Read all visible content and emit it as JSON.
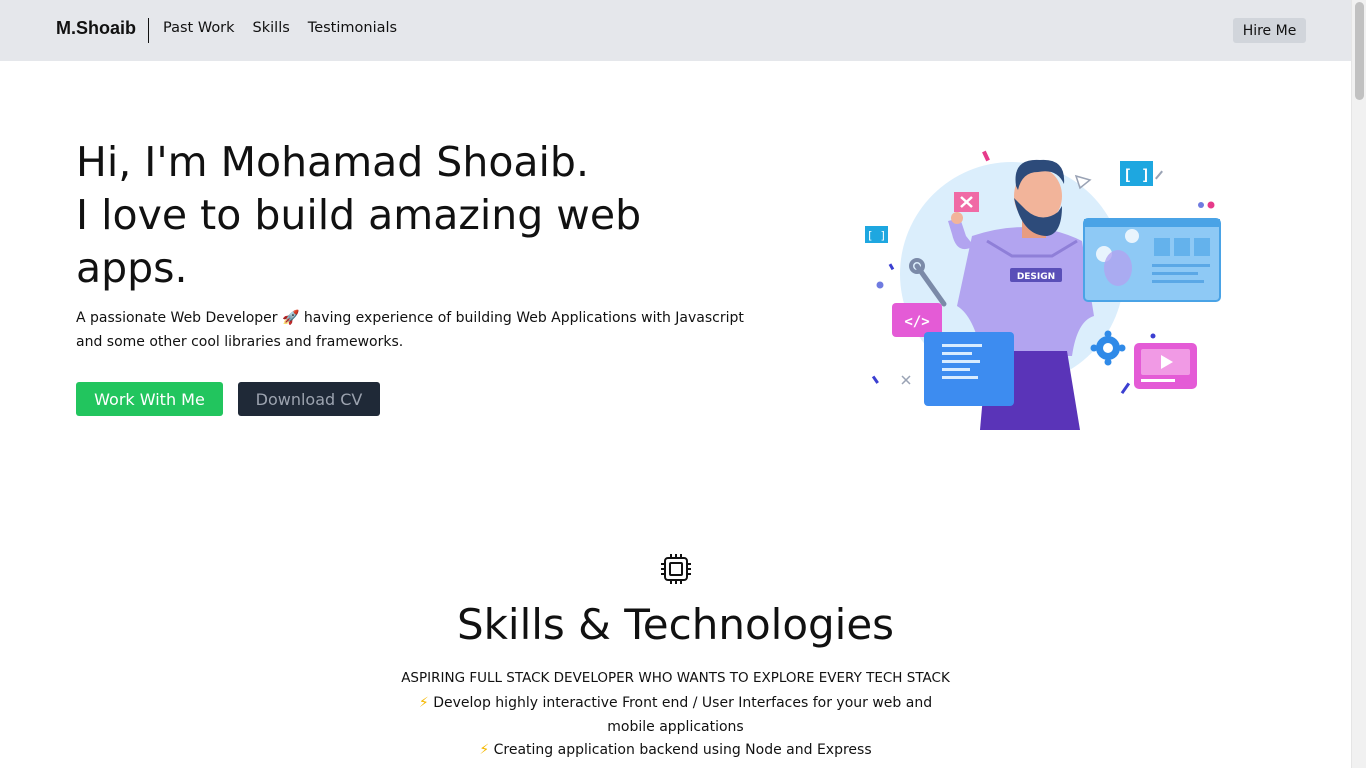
{
  "nav": {
    "brand": "M.Shoaib",
    "links": [
      "Past Work",
      "Skills",
      "Testimonials"
    ],
    "hire_label": "Hire Me"
  },
  "hero": {
    "title_lines": [
      "Hi, I'm Mohamad Shoaib.",
      "I love to build amazing web",
      "apps."
    ],
    "description": "A passionate Web Developer 🚀 having experience of building Web Applications with Javascript and some other cool libraries and frameworks.",
    "primary_button": "Work With Me",
    "secondary_button": "Download CV",
    "illustration_badge": "DESIGN",
    "illustration_code_glyph": "</>",
    "illustration_bracket_glyph": "[ ]"
  },
  "skills": {
    "icon": "chip-icon",
    "title": "Skills & Technologies",
    "subtitle": "ASPIRING FULL STACK DEVELOPER WHO WANTS TO EXPLORE EVERY TECH STACK",
    "items": [
      "Develop highly interactive Front end / User Interfaces for your web and mobile applications",
      "Creating application backend using Node and Express"
    ],
    "bullet": "⚡"
  },
  "colors": {
    "nav_bg": "#e5e7eb",
    "primary": "#22c55e",
    "dark": "#1f2937",
    "hire_bg": "#d1d5db"
  }
}
